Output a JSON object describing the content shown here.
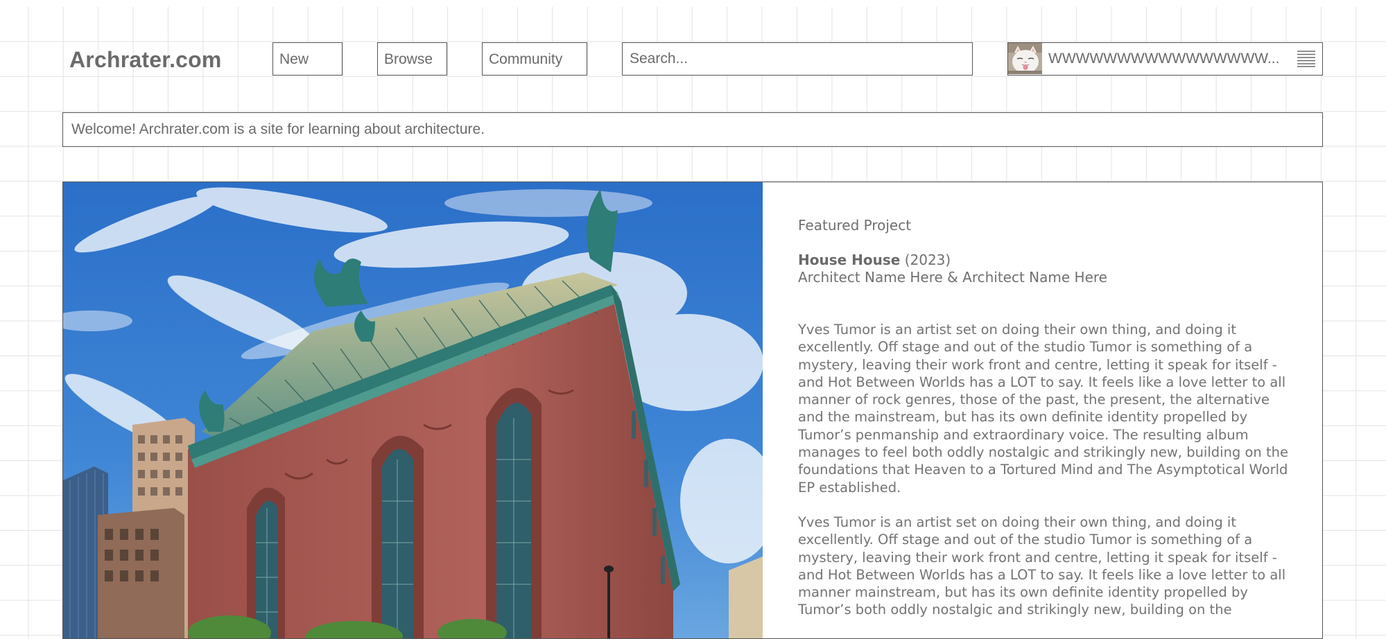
{
  "site": {
    "logo": "Archrater.com"
  },
  "nav": {
    "new_label": "New",
    "browse_label": "Browse",
    "community_label": "Community"
  },
  "search": {
    "placeholder": "Search..."
  },
  "user": {
    "name": "WWWWWWWWWWWWWWWW..."
  },
  "welcome": {
    "text": "Welcome! Archrater.com is a site for learning about architecture."
  },
  "featured": {
    "label": "Featured Project",
    "project_name": "House House",
    "year": "(2023)",
    "architects": "Architect Name Here & Architect Name Here",
    "paragraphs": [
      "Yves Tumor is an artist set on doing their own thing, and doing it excellently. Off stage and out of the studio Tumor is something of a mystery, leaving their work front and centre, letting it speak for itself - and Hot Between Worlds has a LOT to say. It feels like a love letter to all manner of rock genres, those of the past, the present, the alternative and the mainstream, but has its own definite identity propelled by Tumor’s penmanship and extraordinary voice. The resulting album manages to feel both oddly nostalgic and strikingly new, building on the foundations that Heaven to a Tortured Mind and The Asymptotical World EP established.",
      "Yves Tumor is an artist set on doing their own thing, and doing it excellently. Off stage and out of the studio Tumor is something of a mystery, leaving their work front and centre, letting it speak for itself - and Hot Between Worlds has a LOT to say. It feels like a love letter to all manner mainstream, but has its own definite identity propelled by Tumor’s both oddly nostalgic and strikingly new, building on the"
    ]
  },
  "icons": {
    "menu": "menu-icon",
    "avatar": "cat-avatar"
  },
  "colors": {
    "border": "#555555",
    "text": "#6a6a6a",
    "grid": "#e3e3e3",
    "sky": "#2f73c9",
    "facade": "#a85a52",
    "roof": "#3f8f8a"
  }
}
